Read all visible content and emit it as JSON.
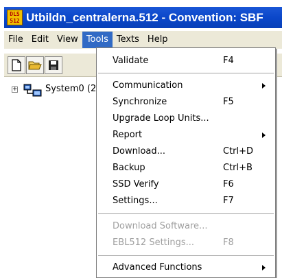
{
  "window": {
    "title": "Utbildn_centralerna.512 - Convention: SBF",
    "app_icon_text": [
      "DLS",
      "512"
    ]
  },
  "menubar": {
    "items": [
      "File",
      "Edit",
      "View",
      "Tools",
      "Texts",
      "Help"
    ],
    "active": "Tools"
  },
  "toolbar": {
    "buttons": [
      "new-document-icon",
      "open-folder-icon",
      "save-disk-icon"
    ]
  },
  "tree": {
    "expander": "+",
    "root_label": "System0 (2"
  },
  "tools_menu": {
    "validate": {
      "label": "Validate",
      "shortcut": "F4"
    },
    "communication": {
      "label": "Communication"
    },
    "synchronize": {
      "label": "Synchronize",
      "shortcut": "F5"
    },
    "upgrade_loop_units": {
      "label": "Upgrade Loop Units..."
    },
    "report": {
      "label": "Report"
    },
    "download": {
      "label": "Download...",
      "shortcut": "Ctrl+D"
    },
    "backup": {
      "label": "Backup",
      "shortcut": "Ctrl+B"
    },
    "ssd_verify": {
      "label": "SSD Verify",
      "shortcut": "F6"
    },
    "settings": {
      "label": "Settings...",
      "shortcut": "F7"
    },
    "download_software": {
      "label": "Download Software..."
    },
    "ebl512_settings": {
      "label": "EBL512 Settings...",
      "shortcut": "F8"
    },
    "advanced_functions": {
      "label": "Advanced Functions"
    }
  },
  "colors": {
    "titlebar": "#0a46c8",
    "menu_highlight": "#316ac5",
    "menubar_bg": "#ece9d8",
    "disabled_text": "#a0a0a0"
  }
}
